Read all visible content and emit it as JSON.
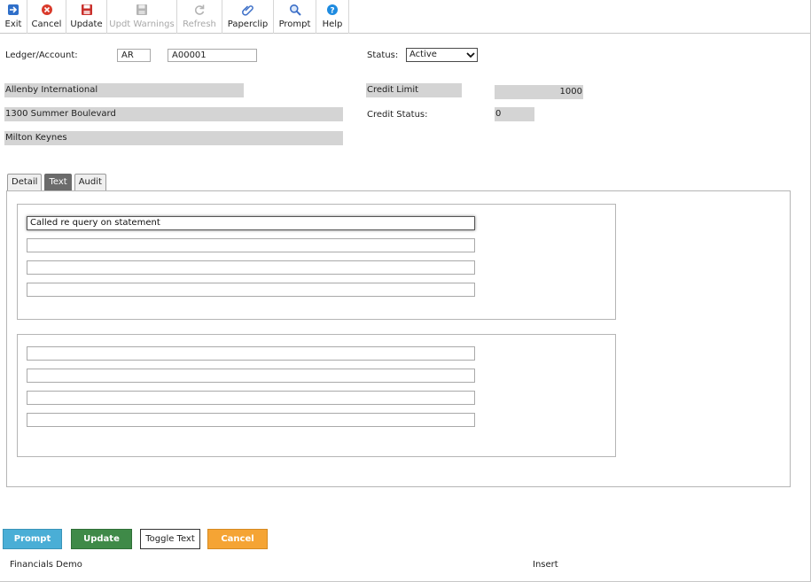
{
  "toolbar": {
    "items": [
      {
        "label": "Exit",
        "icon": "exit-icon",
        "color": "#2f6fc9",
        "enabled": true
      },
      {
        "label": "Cancel",
        "icon": "cancel-icon",
        "color": "#d93a2b",
        "enabled": true
      },
      {
        "label": "Update",
        "icon": "save-icon",
        "color": "#c9302c",
        "enabled": true
      },
      {
        "label": "Updt Warnings",
        "icon": "save-disabled-icon",
        "color": "#a8a8a8",
        "enabled": false
      },
      {
        "label": "Refresh",
        "icon": "refresh-icon",
        "color": "#a8a8a8",
        "enabled": false
      },
      {
        "label": "Paperclip",
        "icon": "paperclip-icon",
        "color": "#3b6ec7",
        "enabled": true
      },
      {
        "label": "Prompt",
        "icon": "magnifier-icon",
        "color": "#3b6ec7",
        "enabled": true
      },
      {
        "label": "Help",
        "icon": "help-icon",
        "color": "#1e8be0",
        "enabled": true
      }
    ]
  },
  "header": {
    "ledger_account_label": "Ledger/Account:",
    "ledger_value": "AR",
    "account_value": "A00001",
    "status_label": "Status:",
    "status_value": "Active",
    "name": "Allenby International",
    "address1": "1300 Summer Boulevard",
    "address2": "Milton Keynes",
    "credit_limit_label": "Credit Limit",
    "credit_limit_value": "1000",
    "credit_status_label": "Credit Status:",
    "credit_status_value": "0"
  },
  "tabs": [
    {
      "label": "Detail",
      "active": false
    },
    {
      "label": "Text",
      "active": true
    },
    {
      "label": "Audit",
      "active": false
    }
  ],
  "text_group_1": [
    "Called re query on statement",
    "",
    "",
    ""
  ],
  "text_group_2": [
    "",
    "",
    "",
    ""
  ],
  "buttons": {
    "prompt": "Prompt",
    "update": "Update",
    "toggle_text": "Toggle Text",
    "cancel": "Cancel"
  },
  "statusbar": {
    "app_name": "Financials Demo",
    "mode": "Insert"
  }
}
